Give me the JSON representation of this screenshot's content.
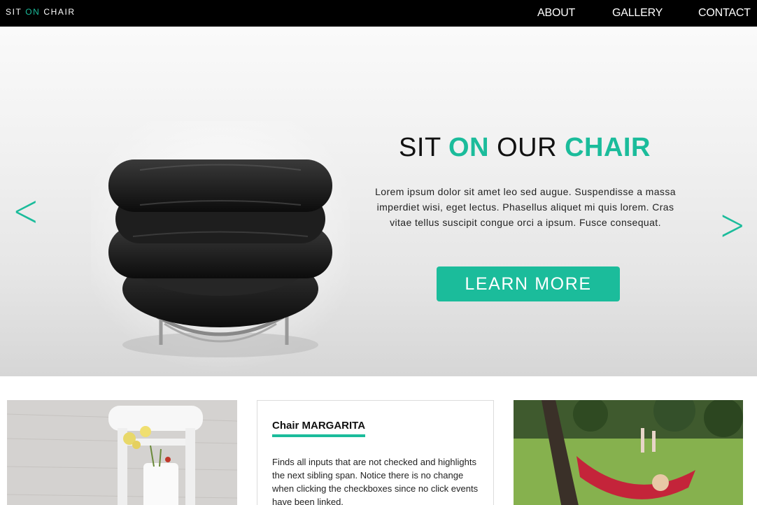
{
  "header": {
    "logo": {
      "part1": "SIT ",
      "part2": "ON",
      "part3": " CHAIR"
    },
    "nav": [
      {
        "label": "ABOUT"
      },
      {
        "label": "GALLERY"
      },
      {
        "label": "CONTACT"
      }
    ]
  },
  "hero": {
    "title": {
      "w1": "SIT ",
      "w2": "ON",
      "w3": " OUR ",
      "w4": "CHAIR"
    },
    "text": "Lorem ipsum dolor sit amet leo sed augue. Suspendisse a massa imperdiet wisi, eget lectus. Phasellus aliquet mi quis lorem. Cras vitae tellus suscipit congue orci a ipsum. Fusce consequat.",
    "button": "LEARN MORE",
    "prev_icon": "chevron-left-icon",
    "next_icon": "chevron-right-icon"
  },
  "cards": [
    {
      "image": "white-chair-flowers-photo"
    },
    {
      "title": "Chair MARGARITA",
      "body": "Finds all inputs that are not checked and highlights the next sibling span. Notice there is no change when clicking the checkboxes since no click events have been linked."
    },
    {
      "image": "hammock-park-photo"
    }
  ],
  "colors": {
    "accent": "#1bbc9b",
    "topbar": "#000000"
  }
}
